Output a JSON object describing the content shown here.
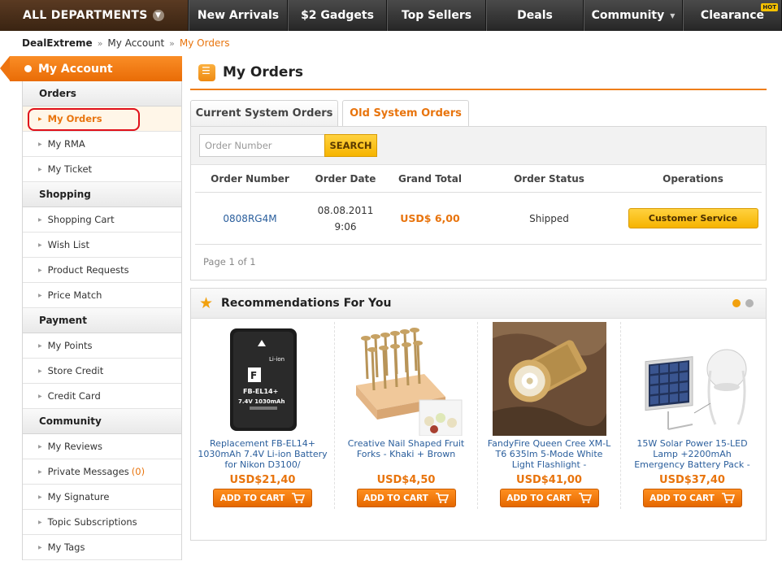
{
  "nav": {
    "departments": "ALL DEPARTMENTS",
    "items": [
      {
        "label": "New Arrivals",
        "width": 122
      },
      {
        "label": "$2 Gadgets",
        "width": 122
      },
      {
        "label": "Top Sellers",
        "width": 122
      },
      {
        "label": "Deals",
        "width": 120
      },
      {
        "label": "Community",
        "width": 122
      },
      {
        "label": "Clearance",
        "width": 122
      }
    ],
    "hot_badge": "HOT"
  },
  "breadcrumb": {
    "home": "DealExtreme",
    "sep1": "»",
    "level1": "My Account",
    "sep2": "»",
    "current": "My Orders"
  },
  "sidebar": {
    "title": "My Account",
    "sections": [
      {
        "title": "Orders",
        "items": [
          {
            "label": "My Orders",
            "active": true
          },
          {
            "label": "My RMA"
          },
          {
            "label": "My Ticket"
          }
        ]
      },
      {
        "title": "Shopping",
        "items": [
          {
            "label": "Shopping Cart"
          },
          {
            "label": "Wish List"
          },
          {
            "label": "Product Requests"
          },
          {
            "label": "Price Match"
          }
        ]
      },
      {
        "title": "Payment",
        "items": [
          {
            "label": "My Points"
          },
          {
            "label": "Store Credit"
          },
          {
            "label": "Credit Card"
          }
        ]
      },
      {
        "title": "Community",
        "items": [
          {
            "label": "My Reviews"
          },
          {
            "label": "Private Messages",
            "count": "(0)"
          },
          {
            "label": "My Signature"
          },
          {
            "label": "Topic Subscriptions"
          },
          {
            "label": "My Tags"
          }
        ]
      }
    ]
  },
  "main": {
    "title": "My Orders",
    "tabs": [
      {
        "label": "Current System Orders"
      },
      {
        "label": "Old System Orders",
        "active": true
      }
    ],
    "search": {
      "placeholder": "Order Number",
      "button": "SEARCH"
    },
    "columns": [
      "Order Number",
      "Order Date",
      "Grand Total",
      "Order Status",
      "Operations"
    ],
    "orders": [
      {
        "number": "0808RG4M",
        "date": "08.08.2011",
        "time": "9:06",
        "total": "USD$ 6,00",
        "status": "Shipped",
        "action": "Customer Service"
      }
    ],
    "page_info": "Page 1 of 1"
  },
  "recommendations": {
    "title": "Recommendations For You",
    "add_to_cart": "ADD TO CART",
    "products": [
      {
        "name": "Replacement FB-EL14+ 1030mAh 7.4V Li-ion Battery for Nikon D3100/",
        "price": "USD$21,40",
        "image": "battery",
        "label_top": "Li-ion",
        "label_model": "FB-EL14+",
        "label_spec": "7.4V 1030mAh"
      },
      {
        "name": "Creative Nail Shaped Fruit Forks - Khaki + Brown",
        "price": "USD$4,50",
        "image": "forks"
      },
      {
        "name": "FandyFire Queen Cree XM-L T6 635lm 5-Mode White Light Flashlight -",
        "price": "USD$41,00",
        "image": "flashlight"
      },
      {
        "name": "15W Solar Power 15-LED Lamp +2200mAh Emergency Battery Pack -",
        "price": "USD$37,40",
        "image": "solar"
      }
    ]
  },
  "colors": {
    "accent": "#e8740d",
    "link": "#2a5e9c",
    "button_yellow": "#f6b400"
  }
}
